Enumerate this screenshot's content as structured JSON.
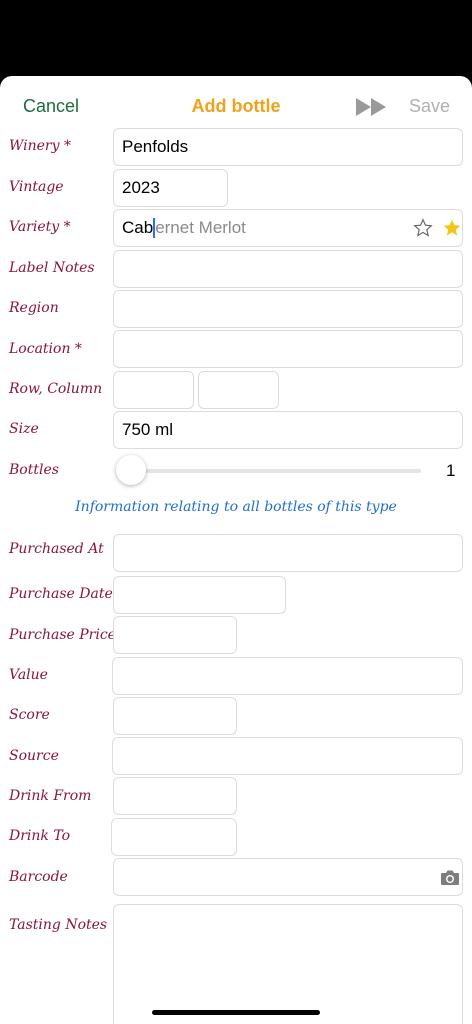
{
  "nav": {
    "cancel": "Cancel",
    "title": "Add bottle",
    "save": "Save"
  },
  "labels": {
    "winery": "Winery *",
    "vintage": "Vintage",
    "variety": "Variety *",
    "label_notes": "Label Notes",
    "region": "Region",
    "location": "Location *",
    "row_column": "Row, Column",
    "size": "Size",
    "bottles": "Bottles",
    "purchased_at": "Purchased At",
    "purchase_date": "Purchase Date",
    "purchase_price": "Purchase Price",
    "value": "Value",
    "score": "Score",
    "source": "Source",
    "drink_from": "Drink From",
    "drink_to": "Drink To",
    "barcode": "Barcode",
    "tasting_notes": "Tasting Notes"
  },
  "values": {
    "winery": "Penfolds",
    "vintage": "2023",
    "variety_typed": "Cab",
    "variety_suggestion": "ernet Merlot",
    "size": "750 ml",
    "bottles": "1"
  },
  "bottles_slider_fraction": 0,
  "info_text": "Information relating to all bottles of this type",
  "icons": {
    "fast_forward": "fast-forward-icon",
    "star_outline": "star-outline-icon",
    "star_filled": "star-filled-icon",
    "camera": "camera-icon"
  },
  "colors": {
    "cancel": "#1f6b3a",
    "title": "#f0a21a",
    "label": "#8a1538",
    "info": "#1f6fd1",
    "star": "#f5c518"
  }
}
